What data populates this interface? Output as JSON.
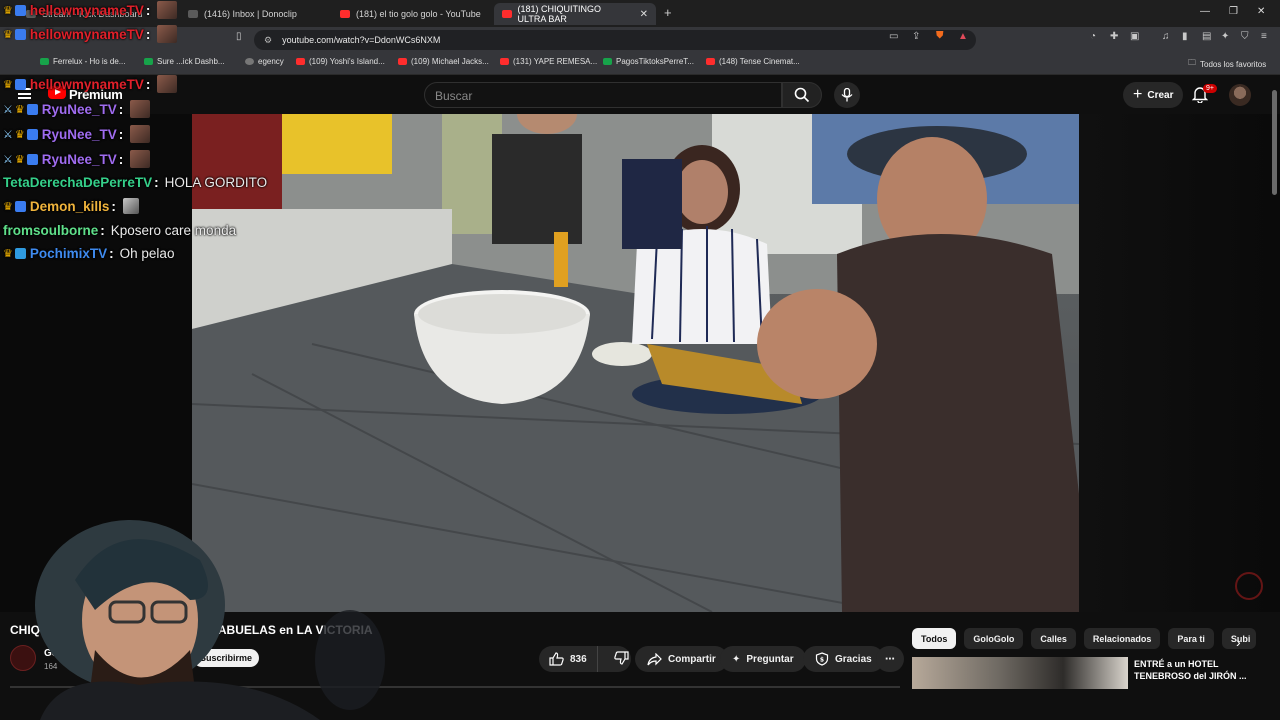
{
  "browser": {
    "tabs": [
      {
        "label": "Stream - Kick Dashboard",
        "active": false
      },
      {
        "label": "(1416) Inbox | Donoclip",
        "active": false
      },
      {
        "label": "(181) el tio golo golo - YouTube",
        "active": false
      },
      {
        "label": "(181) CHIQUITINGO ULTRA BAR",
        "active": true
      }
    ],
    "url": "youtube.com/watch?v=DdonWCs6NXM",
    "bookmarks": [
      {
        "label": "Ferrelux - Ho is de..."
      },
      {
        "label": "Sure ...ick Dashb..."
      },
      {
        "label": "egency"
      },
      {
        "label": "(109) Yoshi's Island..."
      },
      {
        "label": "(109) Michael Jacks..."
      },
      {
        "label": "(131) YAPE REMESA..."
      },
      {
        "label": "PagosTiktoksPerreT..."
      },
      {
        "label": "(148) Tense Cinemat..."
      }
    ],
    "all_bookmarks": "Todos los favoritos"
  },
  "youtube": {
    "brand": "Premium",
    "search_placeholder": "Buscar",
    "create_label": "Crear",
    "notif_badge": "9+",
    "video_title_start": "CHIQU",
    "video_title_end": "con ABUELAS en LA VICTORIA",
    "channel_name": "Go",
    "subscriber_text": "164",
    "subscribe_label": "Suscribirme",
    "likes": "836",
    "share_label": "Compartir",
    "ask_label": "Preguntar",
    "thanks_label": "Gracias",
    "chips": [
      "Todos",
      "GoloGolo",
      "Calles",
      "Relacionados",
      "Para ti",
      "Subi"
    ],
    "recommended": {
      "title": "ENTRÉ a un HOTEL TENEBROSO del JIRÓN ..."
    }
  },
  "chat": {
    "messages": [
      {
        "user": "hellowmynameTV",
        "color": "#e0202a",
        "text": ""
      },
      {
        "user": "hellowmynameTV",
        "color": "#e0202a",
        "text": ""
      },
      {
        "user": "hellowmynameTV",
        "color": "#e0202a",
        "text": ""
      },
      {
        "user": "RyuNee_TV",
        "color": "#a06cf0",
        "text": ""
      },
      {
        "user": "RyuNee_TV",
        "color": "#a06cf0",
        "text": ""
      },
      {
        "user": "RyuNee_TV",
        "color": "#a06cf0",
        "text": ""
      },
      {
        "user": "TetaDerechaDePerreTV",
        "color": "#35d08a",
        "text": "HOLA GORDITO"
      },
      {
        "user": "Demon_kills",
        "color": "#f0b43c",
        "text": ""
      },
      {
        "user": "fromsoulborne",
        "color": "#5fe08a",
        "text": "Kposero care monda"
      },
      {
        "user": "PochimixTV",
        "color": "#3f8bf0",
        "text": "Oh pelao"
      }
    ]
  },
  "colors": {
    "youtube_red": "#ff0000",
    "bg": "#0f0f0f",
    "pill": "#272727"
  }
}
